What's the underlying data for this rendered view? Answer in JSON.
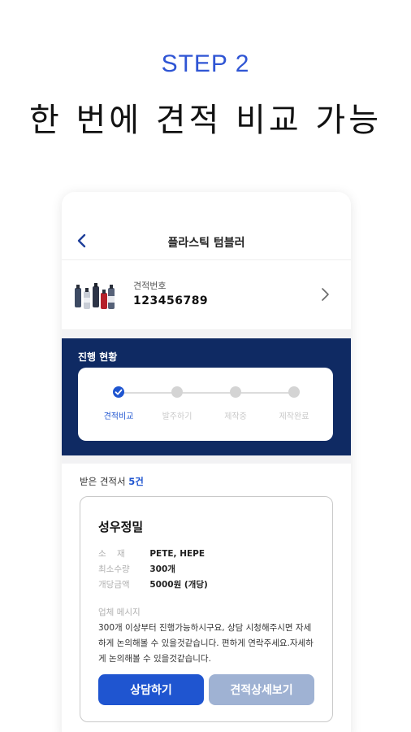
{
  "promo": {
    "step_label": "STEP 2",
    "headline": "한 번에 견적 비교 가능"
  },
  "screen": {
    "title": "플라스틱 텀블러"
  },
  "quote": {
    "number_label": "견적번호",
    "number": "123456789"
  },
  "progress": {
    "title": "진행 현황",
    "steps": [
      {
        "label": "견적비교",
        "active": true
      },
      {
        "label": "발주하기",
        "active": false
      },
      {
        "label": "제작중",
        "active": false
      },
      {
        "label": "제작완료",
        "active": false
      }
    ]
  },
  "received": {
    "prefix": "받은 견적서",
    "count": "5건"
  },
  "card": {
    "company": "성우정밀",
    "specs": [
      {
        "key": "소    재",
        "value": "PETE, HEPE"
      },
      {
        "key": "최소수량",
        "value": "300개"
      },
      {
        "key": "개당금액",
        "value": "5000원 (개당)"
      }
    ],
    "message_title": "업체 메시지",
    "message": "300개 이상부터 진행가능하시구요, 상담 시청해주시면 자세하게 논의해볼 수 있을것같습니다. 편하게 연락주세요.자세하게 논의해볼 수 있을것같습니다.",
    "consult_button": "상담하기",
    "detail_button": "견적상세보기"
  },
  "colors": {
    "accent": "#1f55d0",
    "navy": "#0f2a63",
    "step_blue": "#2f55d4",
    "secondary_button": "#9fb2d3"
  }
}
